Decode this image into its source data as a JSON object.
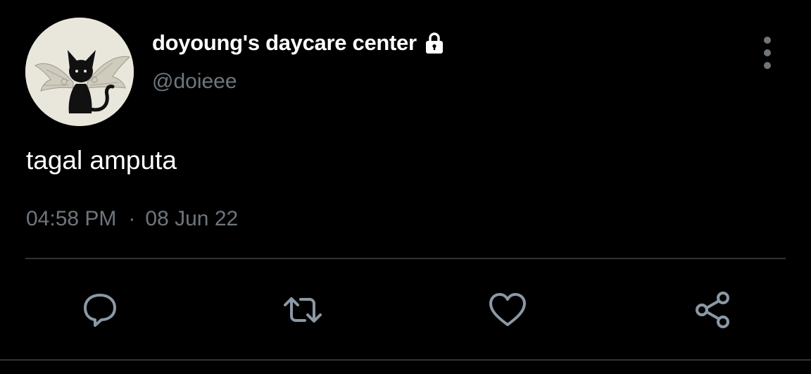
{
  "tweet": {
    "display_name": "doyoung's daycare center",
    "handle": "@doieee",
    "text": "tagal amputa",
    "time": "04:58 PM",
    "separator": "·",
    "date": "08 Jun 22",
    "protected_icon": "lock-icon",
    "avatar_image": "black-winged-cat"
  },
  "actions": [
    {
      "name": "reply",
      "icon": "comment-icon"
    },
    {
      "name": "retweet",
      "icon": "retweet-icon"
    },
    {
      "name": "like",
      "icon": "heart-icon"
    },
    {
      "name": "share",
      "icon": "share-icon"
    }
  ],
  "colors": {
    "background": "#000000",
    "primary_text": "#ffffff",
    "secondary_text": "#6e767d",
    "icon": "#8b98a5",
    "divider": "#2f3336"
  }
}
